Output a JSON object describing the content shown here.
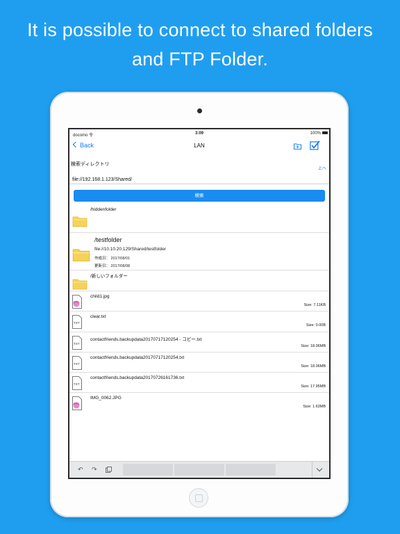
{
  "headline": {
    "line1": "It is possible to connect to shared folders",
    "line2": "and FTP Folder."
  },
  "status_bar": {
    "carrier": "docomo 令",
    "time": "3:09",
    "battery": "100%"
  },
  "nav": {
    "back_label": "Back",
    "title": "LAN",
    "icons": [
      "folder-add-icon",
      "checkbox-check-icon"
    ]
  },
  "search": {
    "directory_label": "検索ディレクトリ",
    "up_label": "上へ",
    "path_value": "file://192.168.1.123/Shared/",
    "button_label": "検索"
  },
  "files": [
    {
      "type": "folder",
      "name": "/hiddenfolder"
    },
    {
      "type": "folder",
      "name": "/testfolder",
      "path": "file://10.10.20.129/Shared/testfolder",
      "created": "作成日： 2017/08/01",
      "modified": "更新日： 2017/08/08"
    },
    {
      "type": "folder",
      "name": "/新しいフォルダー"
    },
    {
      "type": "jpg",
      "name": "child1.jpg",
      "size": "Size: 7.11KB"
    },
    {
      "type": "txt",
      "name": "clear.txt",
      "size": "Size: 0.00B"
    },
    {
      "type": "txt",
      "name": "contactfriends.backupdata20170717120254 - コピー.txt",
      "size": "Size: 18.06MB"
    },
    {
      "type": "txt",
      "name": "contactfriends.backupdata20170717120254.txt",
      "size": "Size: 18.06MB"
    },
    {
      "type": "txt",
      "name": "contactfriends.backupdata20170726161736.txt",
      "size": "Size: 17.95MB"
    },
    {
      "type": "jpg",
      "name": "IMG_0062.JPG",
      "size": "Size: 1.63MB"
    }
  ],
  "file_icon_labels": {
    "jpg": "JPG",
    "txt": ".TXT"
  },
  "keyboard_toolbar": {
    "icons": [
      "undo-icon",
      "redo-icon",
      "paste-icon",
      "chevron-down-icon"
    ]
  },
  "colors": {
    "background": "#1f9ef0",
    "accent": "#1a8cf0",
    "folder": "#f5d35a"
  }
}
